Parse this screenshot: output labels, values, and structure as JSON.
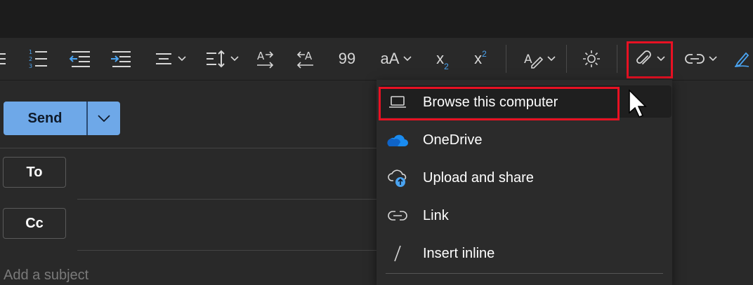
{
  "toolbar": {
    "superscript_glyph": "x",
    "subscript_glyph": "x",
    "font_case_glyph": "aA",
    "quote_glyph": "99"
  },
  "compose": {
    "send_label": "Send",
    "to_label": "To",
    "cc_label": "Cc",
    "subject_placeholder": "Add a subject"
  },
  "attach_menu": {
    "items": [
      {
        "label": "Browse this computer",
        "icon": "laptop-icon"
      },
      {
        "label": "OneDrive",
        "icon": "onedrive-cloud-icon"
      },
      {
        "label": "Upload and share",
        "icon": "cloud-upload-icon"
      },
      {
        "label": "Link",
        "icon": "link-icon"
      },
      {
        "label": "Insert inline",
        "icon": "insert-inline-icon"
      }
    ]
  },
  "colors": {
    "accent": "#6ea8e8",
    "highlight_border": "#e81123",
    "onedrive_blue": "#1a8cf0"
  }
}
